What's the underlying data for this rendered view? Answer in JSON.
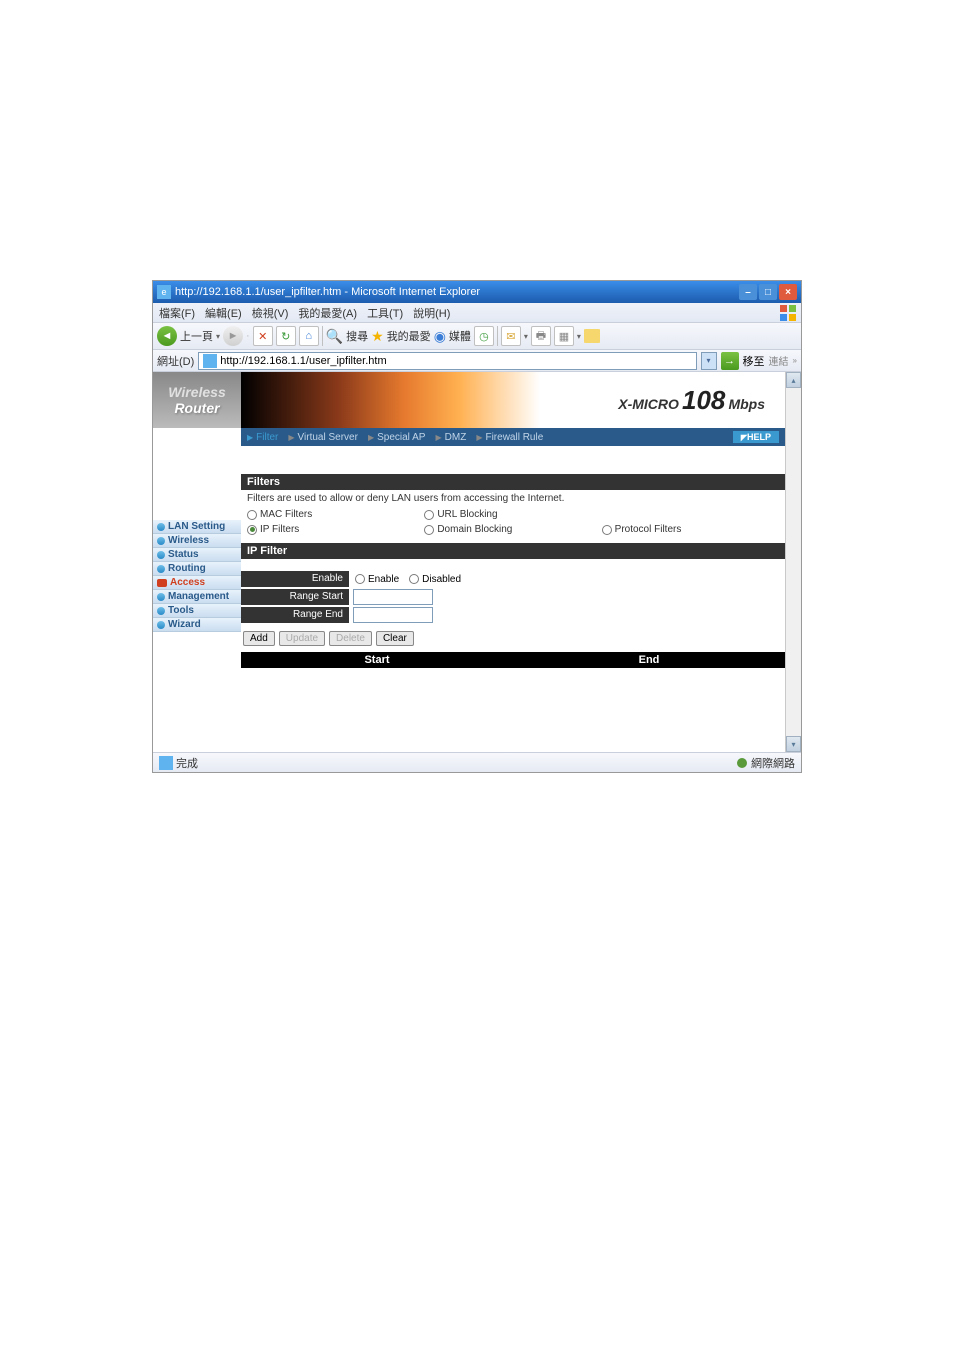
{
  "titlebar": {
    "title": "http://192.168.1.1/user_ipfilter.htm - Microsoft Internet Explorer"
  },
  "menubar": {
    "items": [
      "檔案(F)",
      "編輯(E)",
      "檢視(V)",
      "我的最愛(A)",
      "工具(T)",
      "說明(H)"
    ]
  },
  "toolbar": {
    "back": "上一頁",
    "search": "搜尋",
    "favorites": "我的最愛",
    "media": "媒體"
  },
  "addressbar": {
    "label": "網址(D)",
    "url": "http://192.168.1.1/user_ipfilter.htm",
    "go": "移至",
    "links": "連結"
  },
  "logo": {
    "line1": "Wireless",
    "line2": "Router"
  },
  "sidebar": {
    "items": [
      {
        "label": "LAN Setting"
      },
      {
        "label": "Wireless"
      },
      {
        "label": "Status"
      },
      {
        "label": "Routing"
      },
      {
        "label": "Access"
      },
      {
        "label": "Management"
      },
      {
        "label": "Tools"
      },
      {
        "label": "Wizard"
      }
    ]
  },
  "banner": {
    "brand": "X-MICRO",
    "speed": "108",
    "unit": "Mbps"
  },
  "tabs": {
    "items": [
      "Filter",
      "Virtual Server",
      "Special AP",
      "DMZ",
      "Firewall Rule"
    ],
    "help": "HELP"
  },
  "filters": {
    "header": "Filters",
    "desc": "Filters are used to allow or deny LAN users from accessing the Internet.",
    "options": {
      "mac": "MAC Filters",
      "url": "URL Blocking",
      "ip": "IP Filters",
      "domain": "Domain Blocking",
      "protocol": "Protocol Filters"
    }
  },
  "ipfilter": {
    "header": "IP Filter",
    "enable_label": "Enable",
    "enable_opt": "Enable",
    "disable_opt": "Disabled",
    "range_start": "Range Start",
    "range_end": "Range End"
  },
  "buttons": {
    "add": "Add",
    "update": "Update",
    "delete": "Delete",
    "clear": "Clear"
  },
  "table": {
    "start": "Start",
    "end": "End"
  },
  "statusbar": {
    "done": "完成",
    "network": "網際網路"
  }
}
